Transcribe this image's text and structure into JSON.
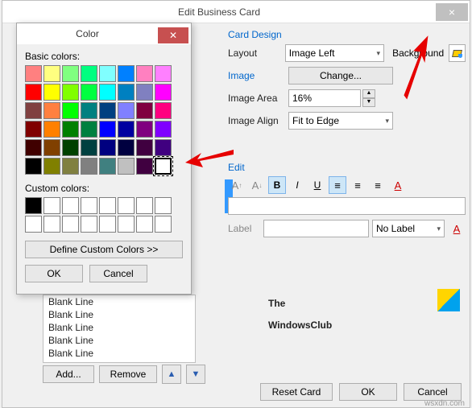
{
  "main": {
    "title": "Edit Business Card"
  },
  "cardDesign": {
    "heading": "Card Design",
    "layoutLabel": "Layout",
    "layoutValue": "Image Left",
    "backgroundLabel": "Background",
    "imageLabel": "Image",
    "changeBtn": "Change...",
    "imageAreaLabel": "Image Area",
    "imageAreaValue": "16%",
    "imageAlignLabel": "Image Align",
    "imageAlignValue": "Fit to Edge"
  },
  "edit": {
    "heading": "Edit",
    "labelText": "Label",
    "noLabel": "No Label"
  },
  "blankList": {
    "items": [
      "Blank Line",
      "Blank Line",
      "Blank Line",
      "Blank Line",
      "Blank Line"
    ],
    "addBtn": "Add...",
    "removeBtn": "Remove"
  },
  "bottom": {
    "reset": "Reset Card",
    "ok": "OK",
    "cancel": "Cancel"
  },
  "logo": {
    "line1": "The",
    "line2": "WindowsClub"
  },
  "footer": "wsxdn.com",
  "colorDialog": {
    "title": "Color",
    "basicLabel": "Basic colors:",
    "customLabel": "Custom colors:",
    "defineBtn": "Define Custom Colors >>",
    "ok": "OK",
    "cancel": "Cancel",
    "basicColors": [
      "#ff8080",
      "#ffff80",
      "#80ff80",
      "#00ff80",
      "#80ffff",
      "#0080ff",
      "#ff80c0",
      "#ff80ff",
      "#ff0000",
      "#ffff00",
      "#80ff00",
      "#00ff40",
      "#00ffff",
      "#0080c0",
      "#8080c0",
      "#ff00ff",
      "#804040",
      "#ff8040",
      "#00ff00",
      "#008080",
      "#004080",
      "#8080ff",
      "#800040",
      "#ff0080",
      "#800000",
      "#ff8000",
      "#008000",
      "#008040",
      "#0000ff",
      "#0000a0",
      "#800080",
      "#8000ff",
      "#400000",
      "#804000",
      "#004000",
      "#004040",
      "#000080",
      "#000040",
      "#400040",
      "#400080",
      "#000000",
      "#808000",
      "#808040",
      "#808080",
      "#408080",
      "#c0c0c0",
      "#400040",
      "#ffffff"
    ],
    "selectedIndex": 47,
    "customColors": [
      "#000000",
      "#ffffff",
      "#ffffff",
      "#ffffff",
      "#ffffff",
      "#ffffff",
      "#ffffff",
      "#ffffff",
      "#ffffff",
      "#ffffff",
      "#ffffff",
      "#ffffff",
      "#ffffff",
      "#ffffff",
      "#ffffff",
      "#ffffff"
    ]
  }
}
